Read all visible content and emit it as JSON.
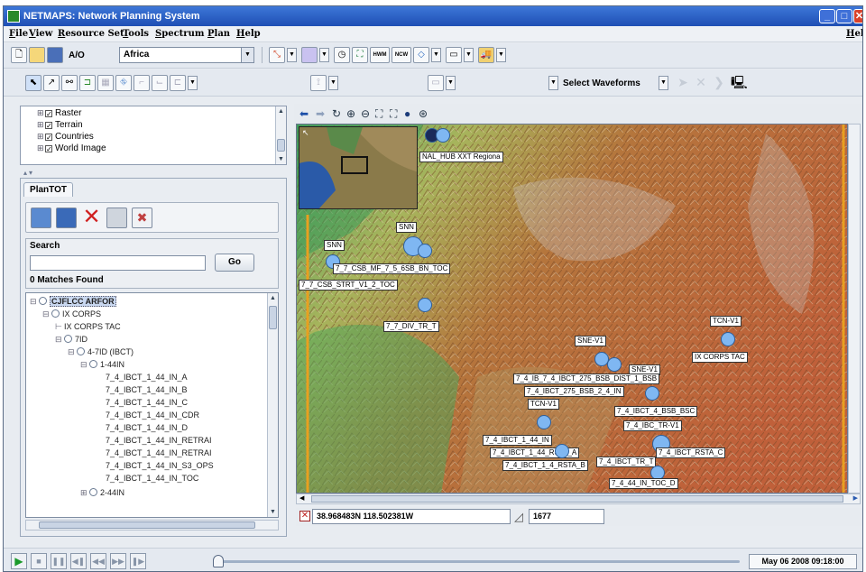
{
  "window": {
    "title": "NETMAPS: Network Planning System"
  },
  "menubar": {
    "items": [
      "File",
      "View",
      "Resource Set",
      "Tools",
      "Spectrum",
      "Plan",
      "Help"
    ],
    "help_right": "Hel"
  },
  "toolbar1": {
    "ao_label": "A/O",
    "region_combo": "Africa",
    "hwm_label": "HWM",
    "ncw_label": "NCW"
  },
  "toolbar2": {
    "waveform_combo": "Select Waveforms"
  },
  "layers": {
    "items": [
      {
        "label": "Raster",
        "checked": true
      },
      {
        "label": "Terrain",
        "checked": true
      },
      {
        "label": "Countries",
        "checked": true
      },
      {
        "label": "World Image",
        "checked": true
      }
    ]
  },
  "plantot": {
    "tab_label": "PlanTOT",
    "search_title": "Search",
    "search_value": "",
    "go_label": "Go",
    "match_count": "0 Matches Found"
  },
  "tree": {
    "nodes": [
      {
        "label": "CJFLCC ARFOR",
        "selected": true
      },
      {
        "label": "IX CORPS"
      },
      {
        "label": "IX CORPS TAC"
      },
      {
        "label": "7ID"
      },
      {
        "label": "4-7ID (IBCT)"
      },
      {
        "label": "1-44IN"
      },
      {
        "label": "7_4_IBCT_1_44_IN_A"
      },
      {
        "label": "7_4_IBCT_1_44_IN_B"
      },
      {
        "label": "7_4_IBCT_1_44_IN_C"
      },
      {
        "label": "7_4_IBCT_1_44_IN_CDR"
      },
      {
        "label": "7_4_IBCT_1_44_IN_D"
      },
      {
        "label": "7_4_IBCT_1_44_IN_RETRAI"
      },
      {
        "label": "7_4_IBCT_1_44_IN_RETRAI"
      },
      {
        "label": "7_4_IBCT_1_44_IN_S3_OPS"
      },
      {
        "label": "7_4_IBCT_1_44_IN_TOC"
      },
      {
        "label": "2-44IN"
      }
    ]
  },
  "map": {
    "unit_labels": [
      "NAL_HUB XXT Regiona",
      "SNN",
      "SNN",
      "7_7_CSB_MF_7_5_6SB_BN_TOC",
      "7_7_CSB_STRT_V1_2_TOC",
      "7_7_DIV_TR_T",
      "TCN-V1",
      "IX CORPS TAC",
      "SNE-V1",
      "SNE-V1",
      "7_4_IB_7_4_IBCT_275_BSB_DIST_1_BSB",
      "7_4_IBCT_275_BSB_2_4_IN",
      "TCN-V1",
      "7_4_IBCT_4_BSB_BSC",
      "7_4_IBC_TR-V1",
      "7_4_IBCT_1_44_IN",
      "7_4_IBCT_1_44_RSTA_A",
      "7_4_IBCT_1_4_RSTA_B",
      "7_4_IBCT_TR_T",
      "7_4_IBCT_RSTA_C",
      "7_4_44_IN_TOC_D"
    ]
  },
  "status": {
    "coordinates": "38.968483N 118.502381W",
    "elevation": "1677"
  },
  "playback": {
    "datetime": "May 06 2008 09:18:00",
    "progress": 0.0
  },
  "colors": {
    "title_bar": "#2a5fc6",
    "unit_marker": "#7fb7f2",
    "boundary_line": "#e8a020"
  }
}
